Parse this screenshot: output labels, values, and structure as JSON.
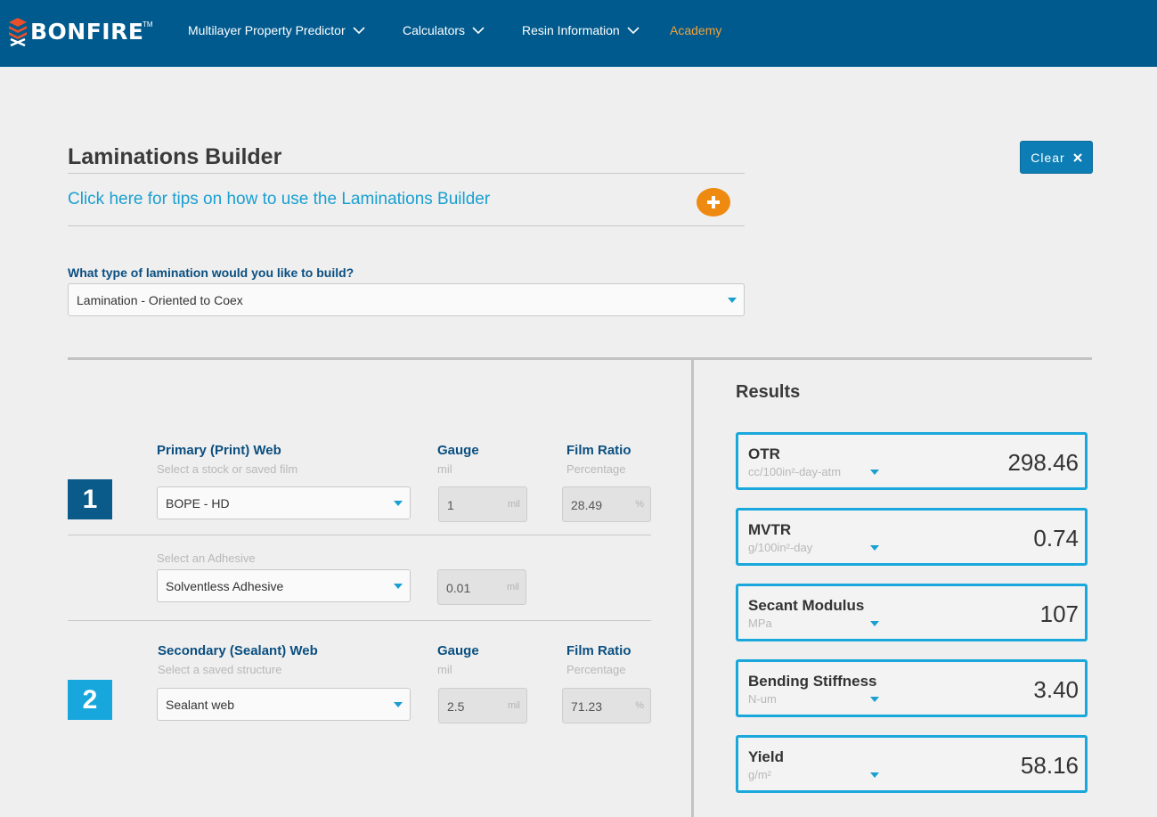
{
  "brand": {
    "name": "BONFIRE",
    "tm": "TM"
  },
  "nav": {
    "items": [
      {
        "label": "Multilayer Property Predictor"
      },
      {
        "label": "Calculators"
      },
      {
        "label": "Resin Information"
      },
      {
        "label": "Academy"
      }
    ]
  },
  "page": {
    "title": "Laminations Builder",
    "tips_link": "Click here for tips on how to use the Laminations Builder",
    "clear_label": "Clear",
    "question": "What type of lamination would you like to build?",
    "lamination_type": "Lamination - Oriented to Coex"
  },
  "primary": {
    "number": "1",
    "label": "Primary (Print) Web",
    "sub": "Select a stock or saved film",
    "selected": "BOPE - HD",
    "gauge_label": "Gauge",
    "gauge_unit_label": "mil",
    "gauge_value": "1",
    "gauge_unit": "mil",
    "ratio_label": "Film Ratio",
    "ratio_sub": "Percentage",
    "ratio_value": "28.49",
    "ratio_unit": "%"
  },
  "adhesive": {
    "sub": "Select an Adhesive",
    "selected": "Solventless Adhesive",
    "gauge_value": "0.01",
    "gauge_unit": "mil"
  },
  "secondary": {
    "number": "2",
    "label": "Secondary (Sealant) Web",
    "sub": "Select a saved structure",
    "selected": "Sealant web",
    "gauge_label": "Gauge",
    "gauge_unit_label": "mil",
    "gauge_value": "2.5",
    "gauge_unit": "mil",
    "ratio_label": "Film Ratio",
    "ratio_sub": "Percentage",
    "ratio_value": "71.23",
    "ratio_unit": "%"
  },
  "results": {
    "title": "Results",
    "items": [
      {
        "name": "OTR",
        "unit": "cc/100in²-day-atm",
        "value": "298.46"
      },
      {
        "name": "MVTR",
        "unit": "g/100in²-day",
        "value": "0.74"
      },
      {
        "name": "Secant Modulus",
        "unit": "MPa",
        "value": "107"
      },
      {
        "name": "Bending Stiffness",
        "unit": "N-um",
        "value": "3.40"
      },
      {
        "name": "Yield",
        "unit": "g/m²",
        "value": "58.16"
      }
    ]
  },
  "colors": {
    "header": "#005a8e",
    "accent": "#1aa0d0",
    "orange": "#ee8a0f",
    "academy": "#f0a23c"
  }
}
